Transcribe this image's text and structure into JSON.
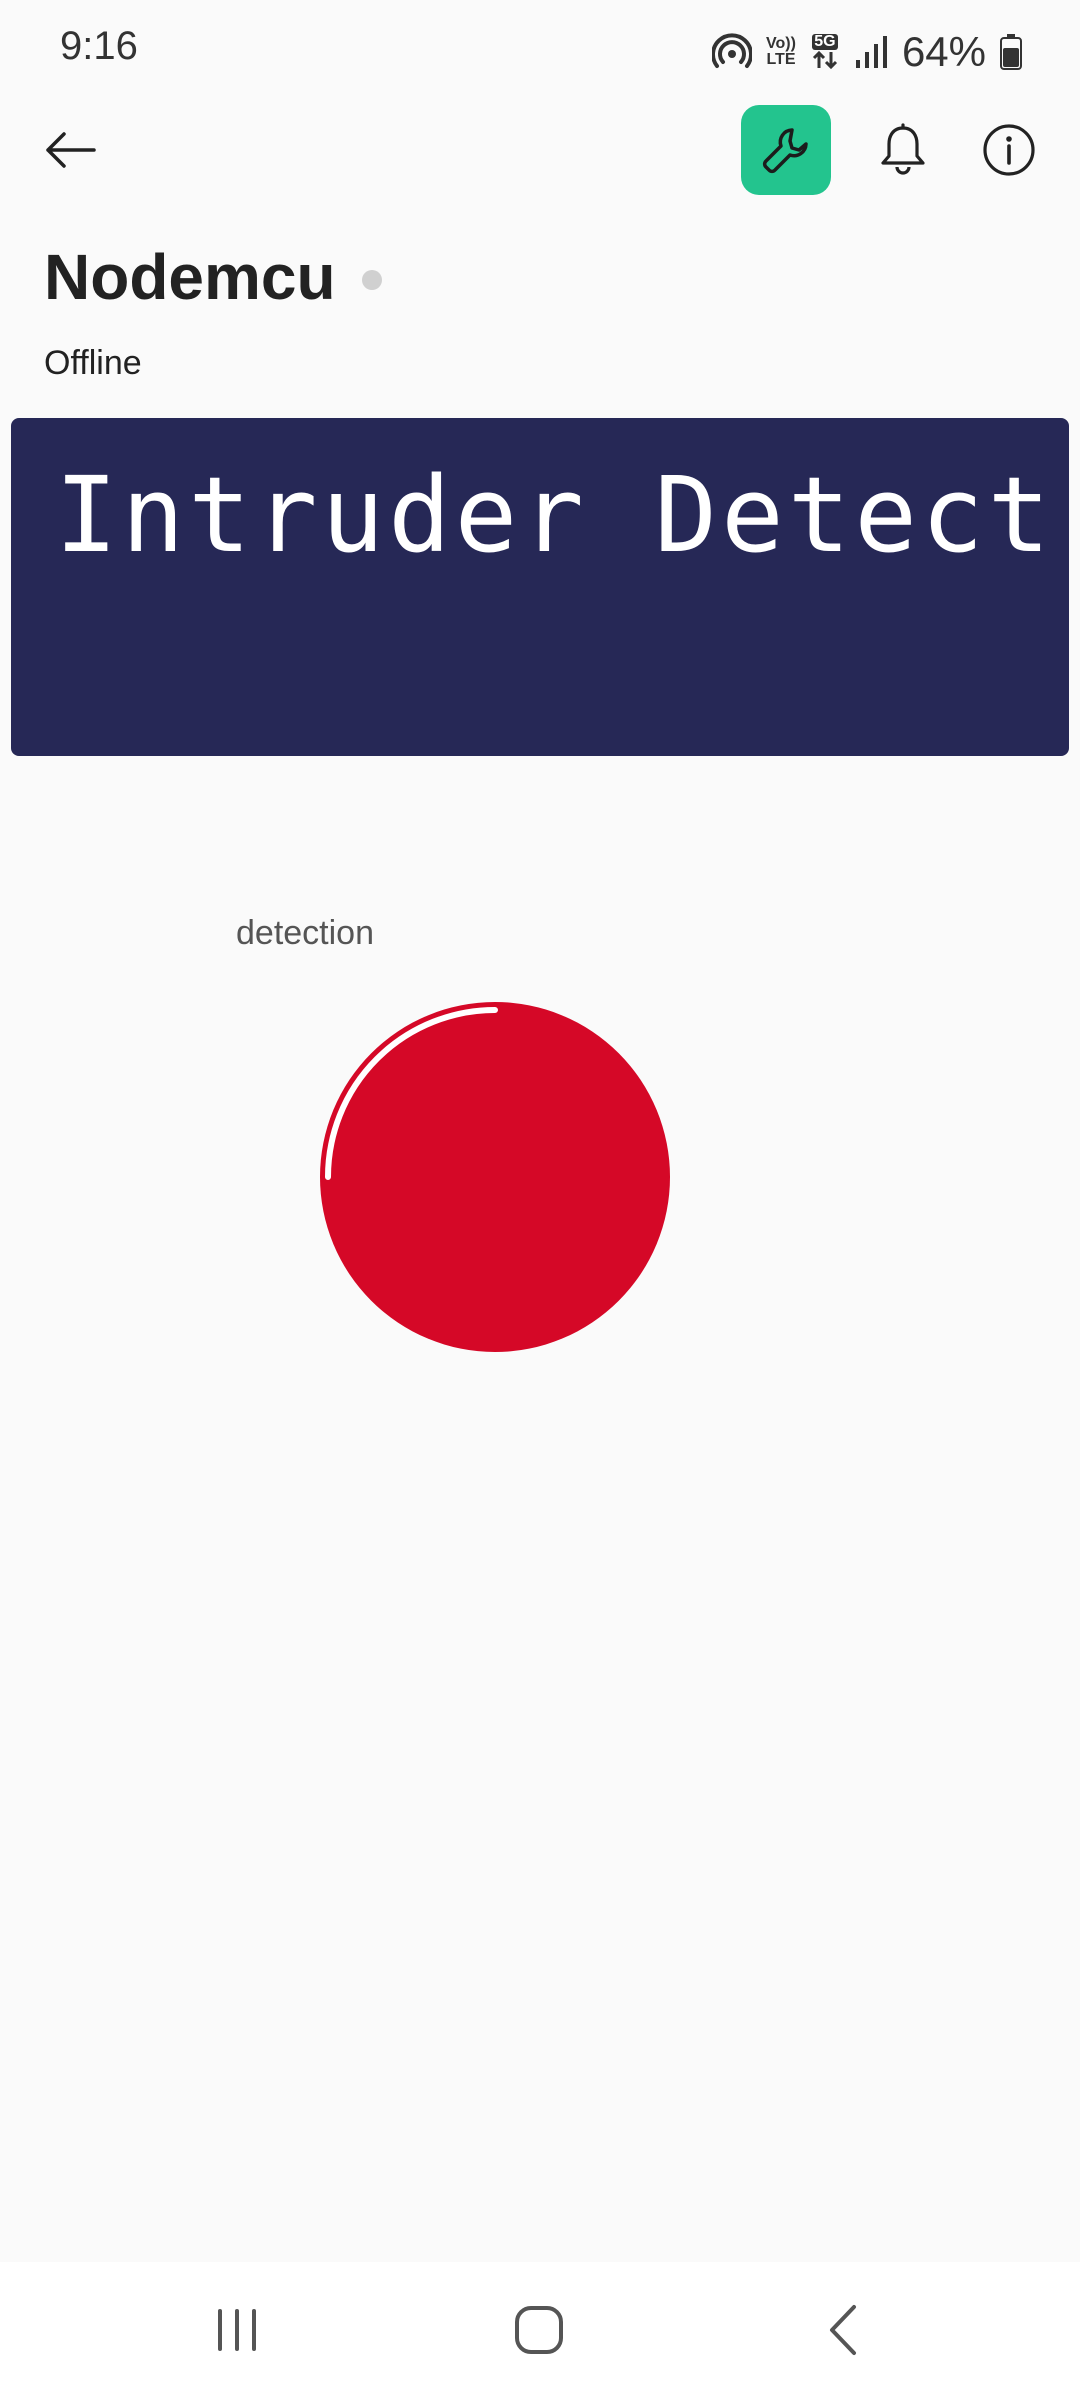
{
  "status_bar": {
    "time": "9:16",
    "volte_top": "Vo))",
    "volte_bottom": "LTE",
    "network": "5G",
    "battery": "64%"
  },
  "header": {
    "back_icon": "arrow-left-icon",
    "settings_icon": "wrench-icon",
    "notifications_icon": "bell-icon",
    "info_icon": "info-icon",
    "accent_color": "#23c48e"
  },
  "device": {
    "name": "Nodemcu",
    "status": "Offline"
  },
  "lcd": {
    "line1": "Intruder Detect",
    "background": "#262856"
  },
  "led_widget": {
    "label": "detection",
    "color": "#d50827"
  },
  "nav": {
    "recents_icon": "recents-icon",
    "home_icon": "home-icon",
    "back_icon": "chevron-left-icon"
  }
}
